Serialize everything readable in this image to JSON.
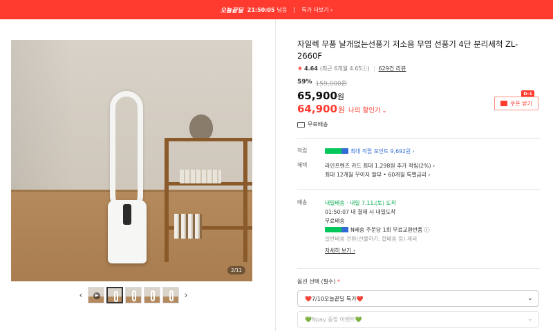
{
  "topbar": {
    "brand": "오늘끝딜",
    "timer": "21:50:05",
    "remain": "남음",
    "more": "특가 더보기 ›"
  },
  "gallery": {
    "counter": "2/11",
    "prev": "‹",
    "next": "›",
    "thumb_count": 5,
    "active_thumb": 2
  },
  "product": {
    "title": "자일렉 무풍 날개없는선풍기 저소음 무엽 선풍기 4단 분리세척 ZL-2660F",
    "rating": "4.64",
    "rating_sub": "(최근 6개월 4.65ⓘ)",
    "reviews": "629건 리뷰",
    "discount_pct": "59%",
    "original_price": "159,000원",
    "price": "65,900",
    "my_price": "64,900",
    "won": "원",
    "my_price_label": "나의 할인가",
    "shipping_free": "무료배송"
  },
  "coupon": {
    "dday": "D-1",
    "label": "쿠폰 받기"
  },
  "benefits": {
    "points_label": "적립",
    "points_value": "최대 적립 포인트 9,692원 ›",
    "perk_label": "혜택",
    "perk_line1": "라인프렌즈 카드 최대 1,298원 추가 적립(2%) ›",
    "perk_line2": "최대 12개월 무이자 할부 • 60개월 특별금리 ›"
  },
  "delivery": {
    "label": "배송",
    "tomorrow": "내일배송 · 내일 7.11.(토) 도착",
    "deadline": "01:50:07  내 결제 시 내일도착",
    "free": "무료배송",
    "exchange": "N배송 주문당 1회 무료교환반품 ⓘ",
    "excluded": "일반배송 전환(선물하기, 합배송 등) 제외",
    "details": "자세히 보기 ›"
  },
  "options": {
    "label": "옵션 선택 (필수)",
    "required_mark": "*",
    "first": "❤️7/10오늘끝딜 특가❤️",
    "second": "💚Npay 증정 이벤트💚"
  },
  "colors": {
    "accent": "#ff3b30",
    "npay_green": "#03c75a",
    "link_blue": "#2f6bd3"
  }
}
